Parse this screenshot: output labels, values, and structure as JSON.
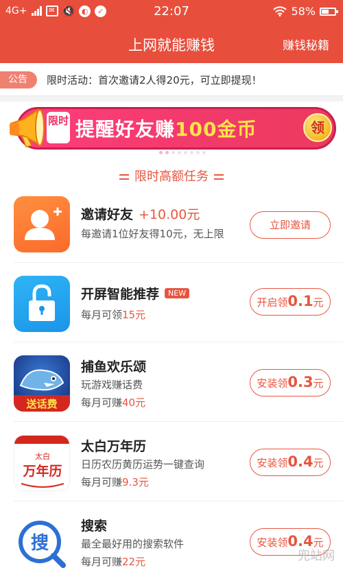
{
  "status_bar": {
    "network": "4G+",
    "time": "22:07",
    "battery": "58%",
    "battery_level": 0.58
  },
  "header": {
    "title": "上网就能赚钱",
    "right_link": "赚钱秘籍"
  },
  "notice": {
    "badge": "公告",
    "text": "限时活动：首次邀请2人得20元，可立即提现！"
  },
  "banner": {
    "tag": "限时",
    "text_prefix": "提醒好友赚",
    "text_highlight": "100金币",
    "coin_label": "领",
    "colors": {
      "pill": "#f23a6a",
      "highlight": "#ffe34a"
    }
  },
  "section_title": "限时高额任务",
  "tasks": [
    {
      "name": "邀请好友",
      "reward": "+10.00元",
      "line1": "每邀请1位好友得10元，无上限",
      "button_label": "立即邀请",
      "icon": "add-user-icon"
    },
    {
      "name": "开屏智能推荐",
      "badge": "NEW",
      "line1_prefix": "每月可领",
      "line1_value": "15元",
      "button_prefix": "开启领",
      "button_amount": "0.1",
      "button_suffix": "元",
      "icon": "unlock-icon"
    },
    {
      "name": "捕鱼欢乐颂",
      "line1": "玩游戏赚话费",
      "line2_prefix": "每月可赚",
      "line2_value": "40元",
      "button_prefix": "安装领",
      "button_amount": "0.3",
      "button_suffix": "元",
      "icon": "fishing-game-icon",
      "icon_caption": "送话费"
    },
    {
      "name": "太白万年历",
      "line1": "日历农历黄历运势一键查询",
      "line2_prefix": "每月可赚",
      "line2_value": "9.3元",
      "button_prefix": "安装领",
      "button_amount": "0.4",
      "button_suffix": "元",
      "icon": "calendar-app-icon",
      "icon_top": "太白",
      "icon_main": "万年历"
    },
    {
      "name": "搜索",
      "line1": "最全最好用的搜索软件",
      "line2_prefix": "每月可赚",
      "line2_value": "22元",
      "button_prefix": "安装领",
      "button_amount": "0.4",
      "button_suffix": "元",
      "icon": "search-app-icon",
      "icon_char": "搜"
    }
  ],
  "watermark": "兜站网",
  "colors": {
    "primary": "#e84e3c",
    "accent": "#e8553f"
  }
}
